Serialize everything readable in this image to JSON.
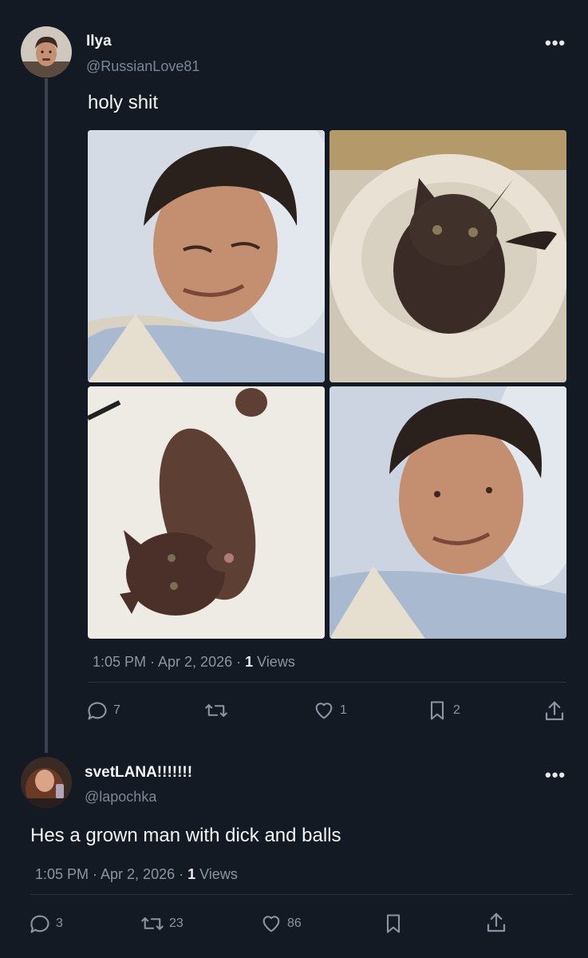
{
  "post1": {
    "author_name": "Ilya",
    "author_handle": "@RussianLove81",
    "more_label": "•••",
    "text": "holy shit",
    "time": "1:05 PM · Apr 2, 2026 · ",
    "views_count": "1",
    "views_label": " Views",
    "images": [
      "man-in-hospital-bed-eyes-closed",
      "dark-kitten-in-pet-bed",
      "brown-kitten-on-blanket",
      "man-in-hospital-bed-smiling"
    ],
    "actions": {
      "reply_count": "7",
      "retweet_count": "",
      "like_count": "1",
      "bookmark_count": "2"
    }
  },
  "post2": {
    "author_name": "svetLANA!!!!!!!",
    "author_handle": "@lapochka",
    "more_label": "•••",
    "text": "Hes a grown man with dick and balls",
    "time": "1:05 PM · Apr 2, 2026 · ",
    "views_count": "1",
    "views_label": " Views",
    "actions": {
      "reply_count": "3",
      "retweet_count": "23",
      "like_count": "86",
      "bookmark_count": ""
    }
  },
  "colors": {
    "background": "#141a24",
    "muted": "#8b95a1",
    "text": "#f2f4f5"
  }
}
